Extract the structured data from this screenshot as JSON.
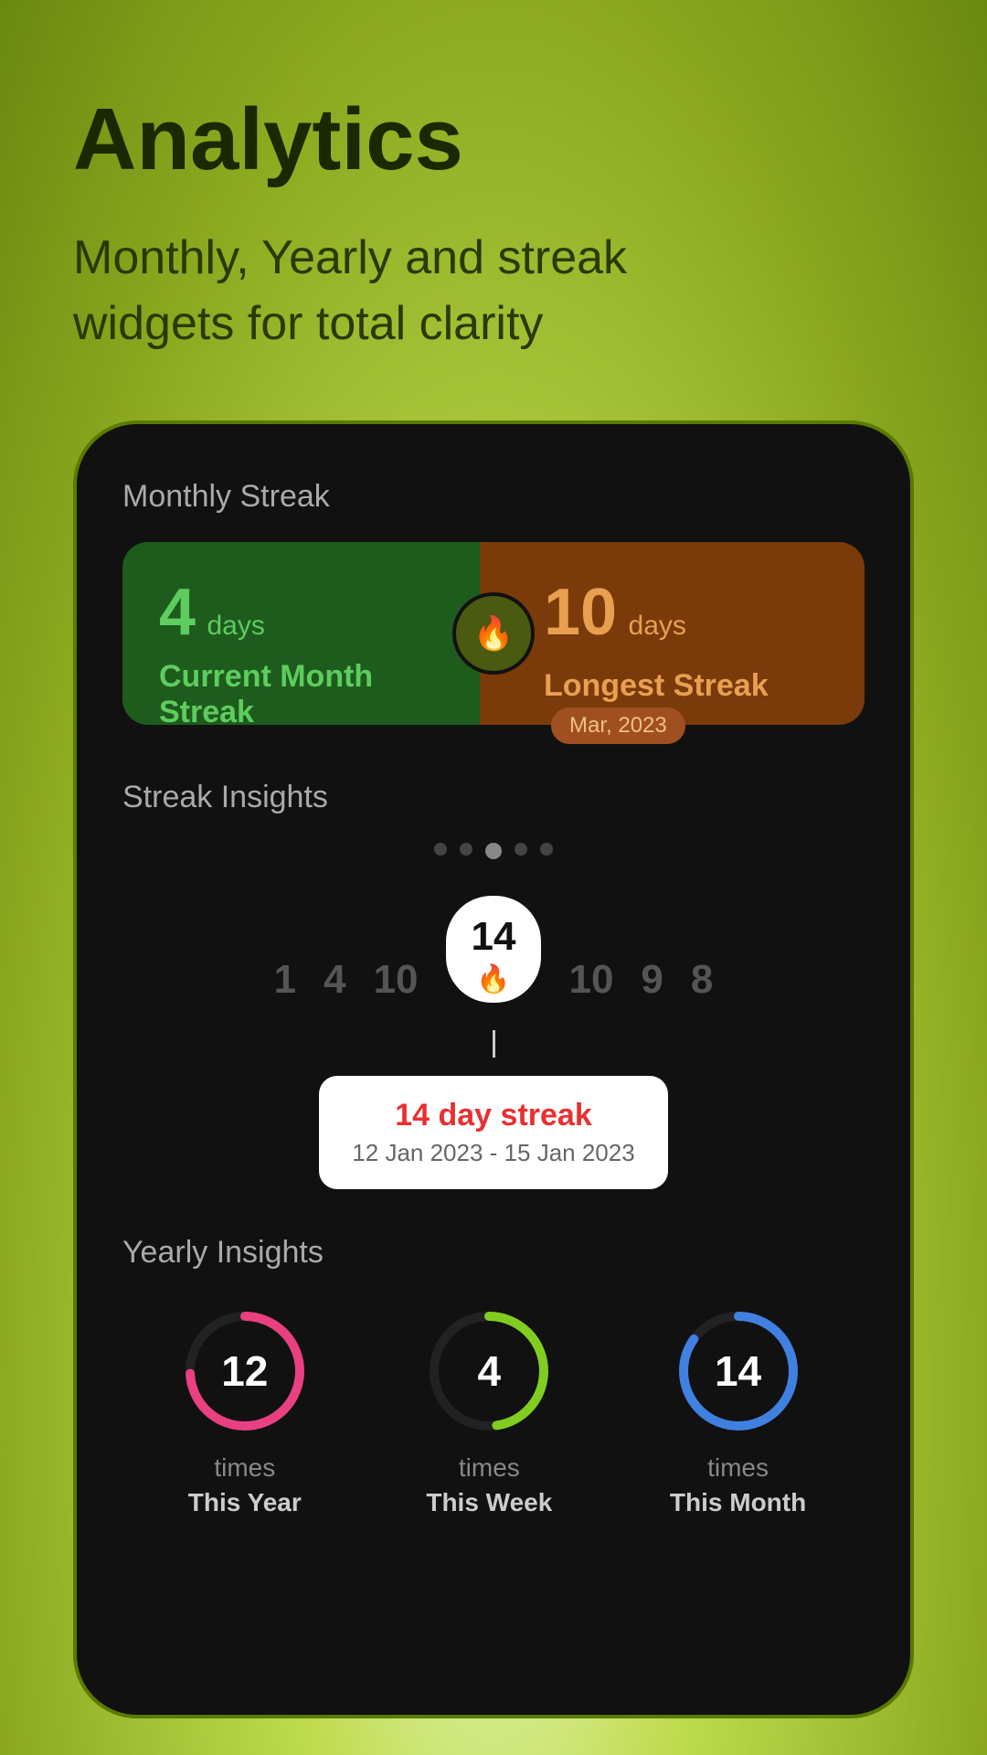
{
  "header": {
    "title": "Analytics",
    "subtitle": "Monthly, Yearly and streak widgets for total clarity"
  },
  "monthly_streak": {
    "section_label": "Monthly Streak",
    "current": {
      "value": "4",
      "unit": "days",
      "label": "Current Month Streak"
    },
    "longest": {
      "value": "10",
      "unit": "days",
      "label": "Longest Streak",
      "date_badge": "Mar, 2023"
    }
  },
  "streak_insights": {
    "section_label": "Streak Insights",
    "bars": [
      "1",
      "4",
      "10",
      "14",
      "10",
      "9",
      "8"
    ],
    "highlighted_index": 3,
    "tooltip": {
      "streak_label": "14 day streak",
      "date_range": "12 Jan 2023 - 15 Jan 2023"
    }
  },
  "yearly_insights": {
    "section_label": "Yearly Insights",
    "circles": [
      {
        "value": "12",
        "times_label": "times",
        "period": "This Year",
        "color": "pink"
      },
      {
        "value": "4",
        "times_label": "times",
        "period": "This Week",
        "color": "green"
      },
      {
        "value": "14",
        "times_label": "times",
        "period": "This Month",
        "color": "blue"
      }
    ]
  },
  "icons": {
    "flame": "🔥"
  }
}
